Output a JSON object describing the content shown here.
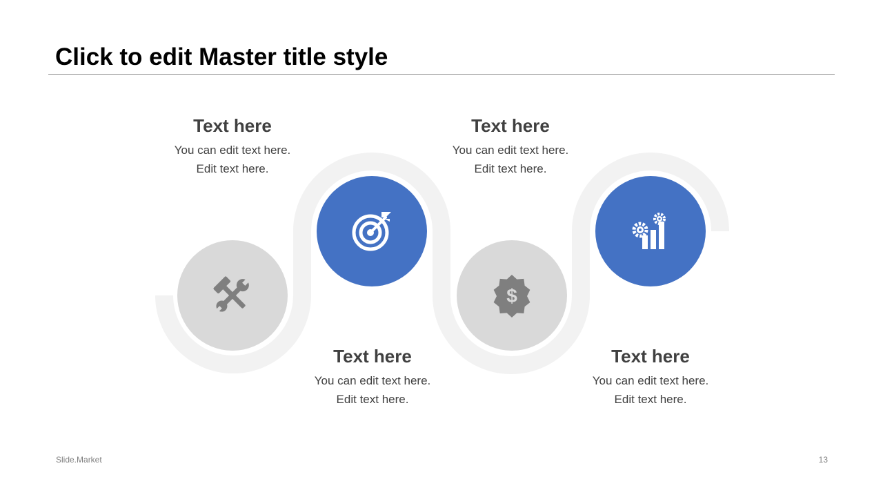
{
  "slide": {
    "title": "Click to edit Master title style",
    "footer": "Slide.Market",
    "page_number": "13"
  },
  "colors": {
    "accent": "#4472C4",
    "grey_node": "#D9D9D9",
    "track": "#F2F2F2",
    "grey_icon": "#7F7F7F",
    "text": "#404040"
  },
  "steps": [
    {
      "heading": "Text here",
      "line1": "You can edit text here.",
      "line2": "Edit text here.",
      "icon": "tools-icon",
      "style": "grey"
    },
    {
      "heading": "Text here",
      "line1": "You can edit text here.",
      "line2": "Edit text here.",
      "icon": "target-icon",
      "style": "accent"
    },
    {
      "heading": "Text here",
      "line1": "You can edit text here.",
      "line2": "Edit text here.",
      "icon": "dollar-badge-icon",
      "style": "grey"
    },
    {
      "heading": "Text here",
      "line1": "You can edit text here.",
      "line2": "Edit text here.",
      "icon": "growth-chart-gears-icon",
      "style": "accent"
    }
  ]
}
